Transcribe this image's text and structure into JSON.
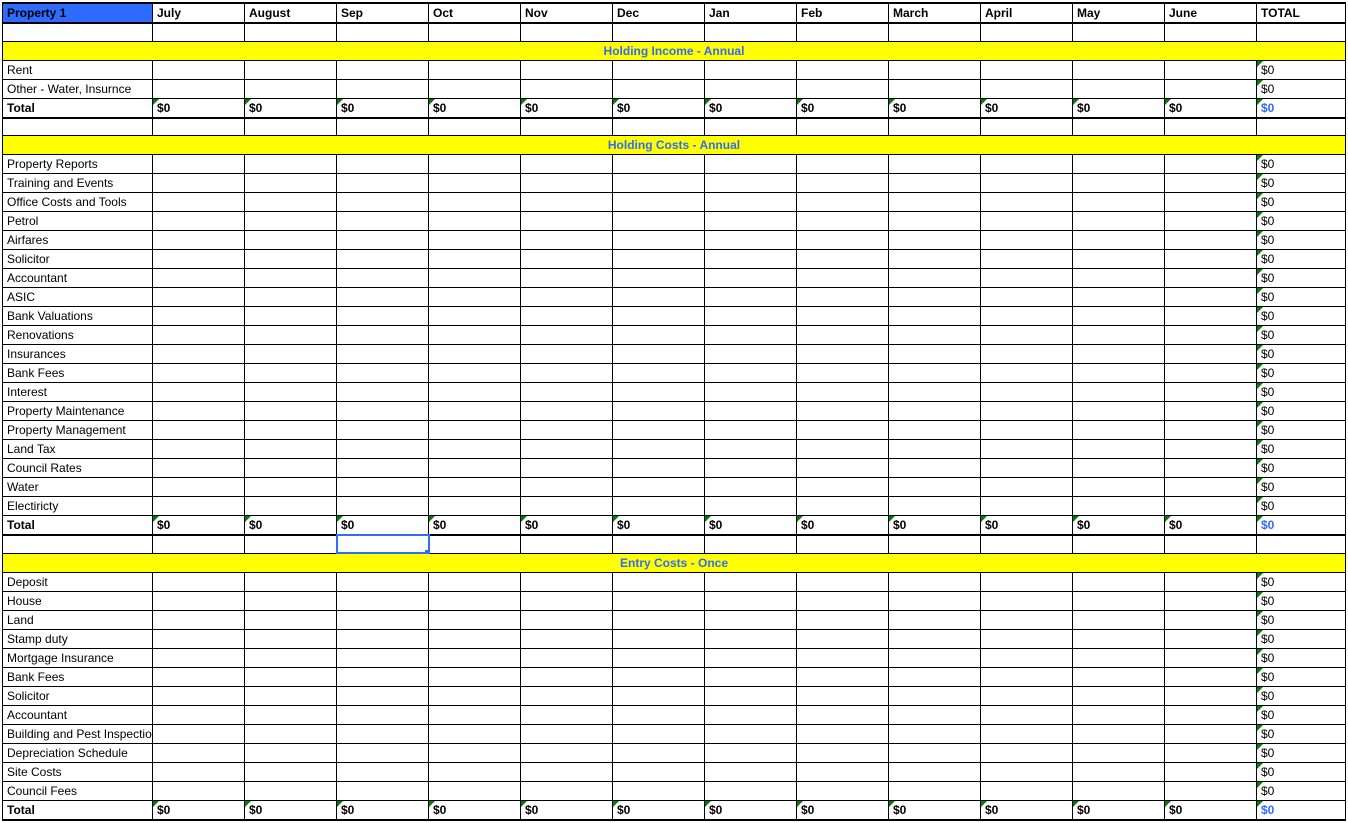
{
  "header": {
    "title": "Property 1",
    "months": [
      "July",
      "August",
      "Sep",
      "Oct",
      "Nov",
      "Dec",
      "Jan",
      "Feb",
      "March",
      "April",
      "May",
      "June"
    ],
    "total_col": "TOTAL"
  },
  "sections": [
    {
      "title": "Holding Income - Annual",
      "rows": [
        {
          "label": "Rent",
          "total": "$0"
        },
        {
          "label": "Other - Water, Insurnce",
          "total": "$0"
        }
      ],
      "total": {
        "label": "Total",
        "month_val": "$0",
        "total": "$0"
      }
    },
    {
      "title": "Holding Costs - Annual",
      "rows": [
        {
          "label": "Property Reports",
          "total": "$0"
        },
        {
          "label": "Training and Events",
          "total": "$0"
        },
        {
          "label": "Office Costs and Tools",
          "total": "$0"
        },
        {
          "label": "Petrol",
          "total": "$0"
        },
        {
          "label": "Airfares",
          "total": "$0"
        },
        {
          "label": "Solicitor",
          "total": "$0"
        },
        {
          "label": "Accountant",
          "total": "$0"
        },
        {
          "label": "ASIC",
          "total": "$0"
        },
        {
          "label": "Bank Valuations",
          "total": "$0"
        },
        {
          "label": "Renovations",
          "total": "$0"
        },
        {
          "label": "Insurances",
          "total": "$0"
        },
        {
          "label": "Bank Fees",
          "total": "$0"
        },
        {
          "label": "Interest",
          "total": "$0"
        },
        {
          "label": "Property Maintenance",
          "total": "$0"
        },
        {
          "label": "Property Management",
          "total": "$0"
        },
        {
          "label": "Land Tax",
          "total": "$0"
        },
        {
          "label": "Council Rates",
          "total": "$0"
        },
        {
          "label": "Water",
          "total": "$0"
        },
        {
          "label": "Electiricty",
          "total": "$0"
        }
      ],
      "total": {
        "label": "Total",
        "month_val": "$0",
        "total": "$0"
      }
    },
    {
      "title": "Entry Costs - Once",
      "rows": [
        {
          "label": "Deposit",
          "total": "$0"
        },
        {
          "label": "House",
          "total": "$0"
        },
        {
          "label": "Land",
          "total": "$0"
        },
        {
          "label": "Stamp duty",
          "total": "$0"
        },
        {
          "label": "Mortgage Insurance",
          "total": "$0"
        },
        {
          "label": "Bank Fees",
          "total": "$0"
        },
        {
          "label": "Solicitor",
          "total": "$0"
        },
        {
          "label": "Accountant",
          "total": "$0"
        },
        {
          "label": "Building and Pest Inspection",
          "total": "$0"
        },
        {
          "label": "Depreciation Schedule",
          "total": "$0"
        },
        {
          "label": "Site Costs",
          "total": "$0"
        },
        {
          "label": "Council Fees",
          "total": "$0"
        }
      ],
      "total": {
        "label": "Total",
        "month_val": "$0",
        "total": "$0"
      }
    }
  ],
  "selected_cell": {
    "section": 1,
    "total_row": true,
    "col": 2
  }
}
